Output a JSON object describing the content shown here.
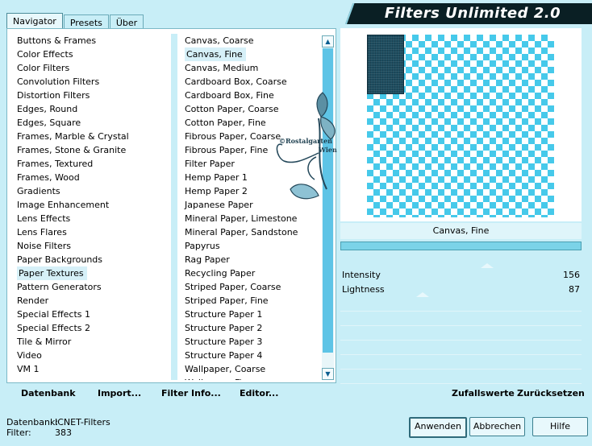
{
  "window": {
    "title": "Filters Unlimited 2.0",
    "tabs": [
      "Navigator",
      "Presets",
      "Über"
    ],
    "active_tab": "Navigator"
  },
  "categories": [
    "Buttons & Frames",
    "Color Effects",
    "Color Filters",
    "Convolution Filters",
    "Distortion Filters",
    "Edges, Round",
    "Edges, Square",
    "Frames, Marble & Crystal",
    "Frames, Stone & Granite",
    "Frames, Textured",
    "Frames, Wood",
    "Gradients",
    "Image Enhancement",
    "Lens Effects",
    "Lens Flares",
    "Noise Filters",
    "Paper Backgrounds",
    "Paper Textures",
    "Pattern Generators",
    "Render",
    "Special Effects 1",
    "Special Effects 2",
    "Tile & Mirror",
    "Video",
    "VM 1"
  ],
  "selected_category": "Paper Textures",
  "filters": [
    "Canvas, Coarse",
    "Canvas, Fine",
    "Canvas, Medium",
    "Cardboard Box, Coarse",
    "Cardboard Box, Fine",
    "Cotton Paper, Coarse",
    "Cotton Paper, Fine",
    "Fibrous Paper, Coarse",
    "Fibrous Paper, Fine",
    "Filter Paper",
    "Hemp Paper 1",
    "Hemp Paper 2",
    "Japanese Paper",
    "Mineral Paper, Limestone",
    "Mineral Paper, Sandstone",
    "Papyrus",
    "Rag Paper",
    "Recycling Paper",
    "Striped Paper, Coarse",
    "Striped Paper, Fine",
    "Structure Paper 1",
    "Structure Paper 2",
    "Structure Paper 3",
    "Structure Paper 4",
    "Wallpaper, Coarse",
    "Wallpaper, Fine"
  ],
  "selected_filter": "Canvas, Fine",
  "watermark": {
    "line1": "©Rostalgarten",
    "line2": "Wien"
  },
  "preview": {
    "filter_name": "Canvas, Fine"
  },
  "params": [
    {
      "label": "Intensity",
      "value": "156",
      "level": 0.61
    },
    {
      "label": "Lightness",
      "value": "87",
      "level": 0.34
    }
  ],
  "bottom_links": [
    "Datenbank",
    "Import...",
    "Filter Info...",
    "Editor..."
  ],
  "right_links": [
    "Zufallswerte",
    "Zurücksetzen"
  ],
  "status": {
    "db_label": "Datenbank:",
    "db_value": "ICNET-Filters",
    "filter_label": "Filter:",
    "filter_value": "383"
  },
  "buttons": {
    "apply": "Anwenden",
    "cancel": "Abbrechen",
    "help": "Hilfe"
  },
  "colors": {
    "accent": "#46c9ea",
    "background": "#c8eef7",
    "title_bg": "#0a1f24"
  }
}
